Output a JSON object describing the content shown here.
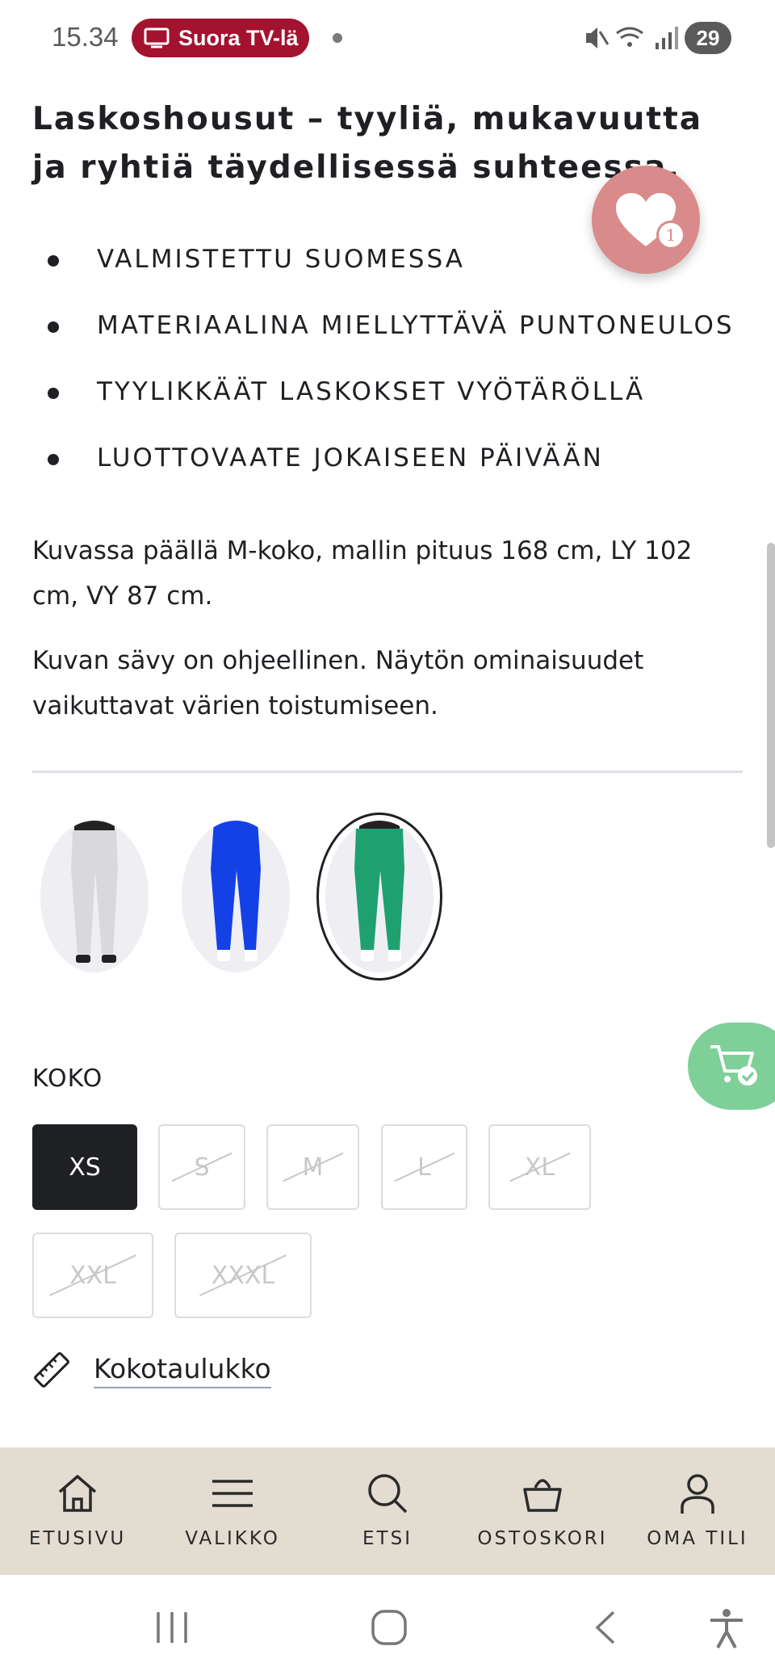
{
  "status_bar": {
    "time": "15.34",
    "tv_label": "Suora TV-lä",
    "battery": "29"
  },
  "product": {
    "heading": "Laskoshousut – tyyliä, mukavuutta ja ryhtiä täydellisessä suhteessa.",
    "favorites_count": "1",
    "features": [
      "VALMISTETTU SUOMESSA",
      "MATERIAALINA MIELLYTTÄVÄ PUNTONEULOS",
      "TYYLIKKÄÄT LASKOKSET VYÖTÄRÖLLÄ",
      "LUOTTOVAATE JOKAISEEN PÄIVÄÄN"
    ],
    "description_1": "Kuvassa päällä M-koko, mallin pituus 168 cm, LY 102 cm, VY 87 cm.",
    "description_2": "Kuvan sävy on ohjeellinen. Näytön ominaisuudet vaikuttavat värien toistumiseen."
  },
  "swatches": [
    {
      "color": "#d9d9dc",
      "selected": false
    },
    {
      "color": "#1441e6",
      "selected": false
    },
    {
      "color": "#1fa071",
      "selected": true
    }
  ],
  "size": {
    "label": "KOKO",
    "options": [
      {
        "label": "XS",
        "available": true,
        "selected": true
      },
      {
        "label": "S",
        "available": false,
        "selected": false
      },
      {
        "label": "M",
        "available": false,
        "selected": false
      },
      {
        "label": "L",
        "available": false,
        "selected": false
      },
      {
        "label": "XL",
        "available": false,
        "selected": false
      },
      {
        "label": "XXL",
        "available": false,
        "selected": false
      },
      {
        "label": "XXXL",
        "available": false,
        "selected": false
      }
    ],
    "chart_link": "Kokotaulukko"
  },
  "bottom_nav": [
    {
      "label": "ETUSIVU",
      "icon": "home-icon"
    },
    {
      "label": "VALIKKO",
      "icon": "menu-icon"
    },
    {
      "label": "ETSI",
      "icon": "search-icon"
    },
    {
      "label": "OSTOSKORI",
      "icon": "basket-icon"
    },
    {
      "label": "OMA TILI",
      "icon": "account-icon"
    }
  ],
  "colors": {
    "text": "#1f2024",
    "favorite": "#d98a8a",
    "cart": "#7fcf98",
    "nav_background": "#e2ddd0",
    "tv_pill": "#a3122f"
  }
}
